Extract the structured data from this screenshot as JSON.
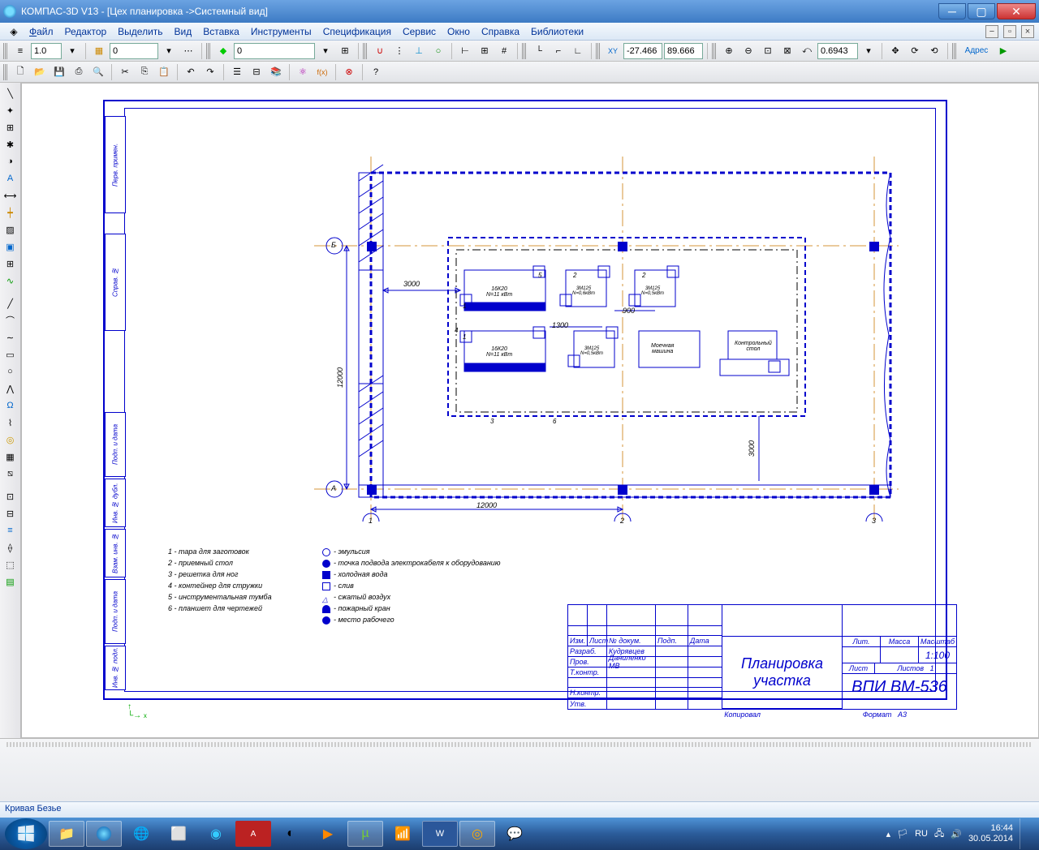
{
  "window": {
    "title": "КОМПАС-3D V13 - [Цех планировка ->Системный вид]"
  },
  "menu": {
    "file": "Файл",
    "edit": "Редактор",
    "select": "Выделить",
    "view": "Вид",
    "insert": "Вставка",
    "tools": "Инструменты",
    "spec": "Спецификация",
    "service": "Сервис",
    "window": "Окно",
    "help": "Справка",
    "libs": "Библиотеки"
  },
  "toolbar1": {
    "scale": "1.0",
    "zero": "0",
    "step": "0"
  },
  "toolbar2": {
    "coordX": "-27.466",
    "coordY": "89.666",
    "zoom": "0.6943"
  },
  "address": {
    "label": "Адрес"
  },
  "drawing": {
    "dims": {
      "d3000": "3000",
      "d12000v": "12000",
      "d1300": "1300",
      "d900": "900",
      "d3000v": "3000",
      "d12000h": "12000"
    },
    "machines": {
      "m1": "16К20\\nN=11 кВт",
      "m2": "16К20\\nN=11 кВт",
      "m3": "3М125\\nN=0,6 кВт",
      "m4": "3М125\\nN=0,5 кВт",
      "m5": "3М125\\nN=0,5 кВт",
      "m6": "Моечная\\nмашина",
      "m7": "Контрольный\\nстол"
    },
    "gridLabels": {
      "a": "А",
      "b": "Б",
      "n1": "1",
      "n2": "2",
      "n3": "3"
    }
  },
  "legend": {
    "l1": "1 - тара для заготовок",
    "l2": "2 - приемный стол",
    "l3": "3 - решетка для ног",
    "l4": "4 - контейнер для стружки",
    "l5": "5 - инструментальная тумба",
    "l6": "6 - планшет для чертежей",
    "r1": "эмульсия",
    "r2": "точка подвода электрокабеля к оборудованию",
    "r3": "холодная вода",
    "r4": "слив",
    "r5": "сжатый воздух",
    "r6": "пожарный кран",
    "r7": "место рабочего"
  },
  "titleBlock": {
    "headers": {
      "izm": "Изм.",
      "list": "Лист",
      "ndoc": "№ докум.",
      "podp": "Подп.",
      "data": "Дата"
    },
    "rows": {
      "razrab": "Разраб.",
      "razrab_name": "Кудрявцев",
      "prov": "Пров.",
      "prov_name": "Даниленко МВ",
      "tkontr": "Т.контр.",
      "nkontr": "Н.контр.",
      "utv": "Утв."
    },
    "docTitle": "Планировка\nучастка",
    "rightTop": {
      "lit": "Лит.",
      "massa": "Масса",
      "masht": "Масштаб",
      "masht_val": "1:100"
    },
    "rightMid": {
      "list": "Лист",
      "listov": "Листов",
      "listov_val": "1"
    },
    "code": "ВПИ ВМ-536",
    "kopiroval": "Копировал",
    "format": "Формат",
    "format_val": "А3"
  },
  "status": {
    "text": "Кривая Безье"
  },
  "tray": {
    "lang": "RU",
    "time": "16:44",
    "date": "30.05.2014"
  }
}
